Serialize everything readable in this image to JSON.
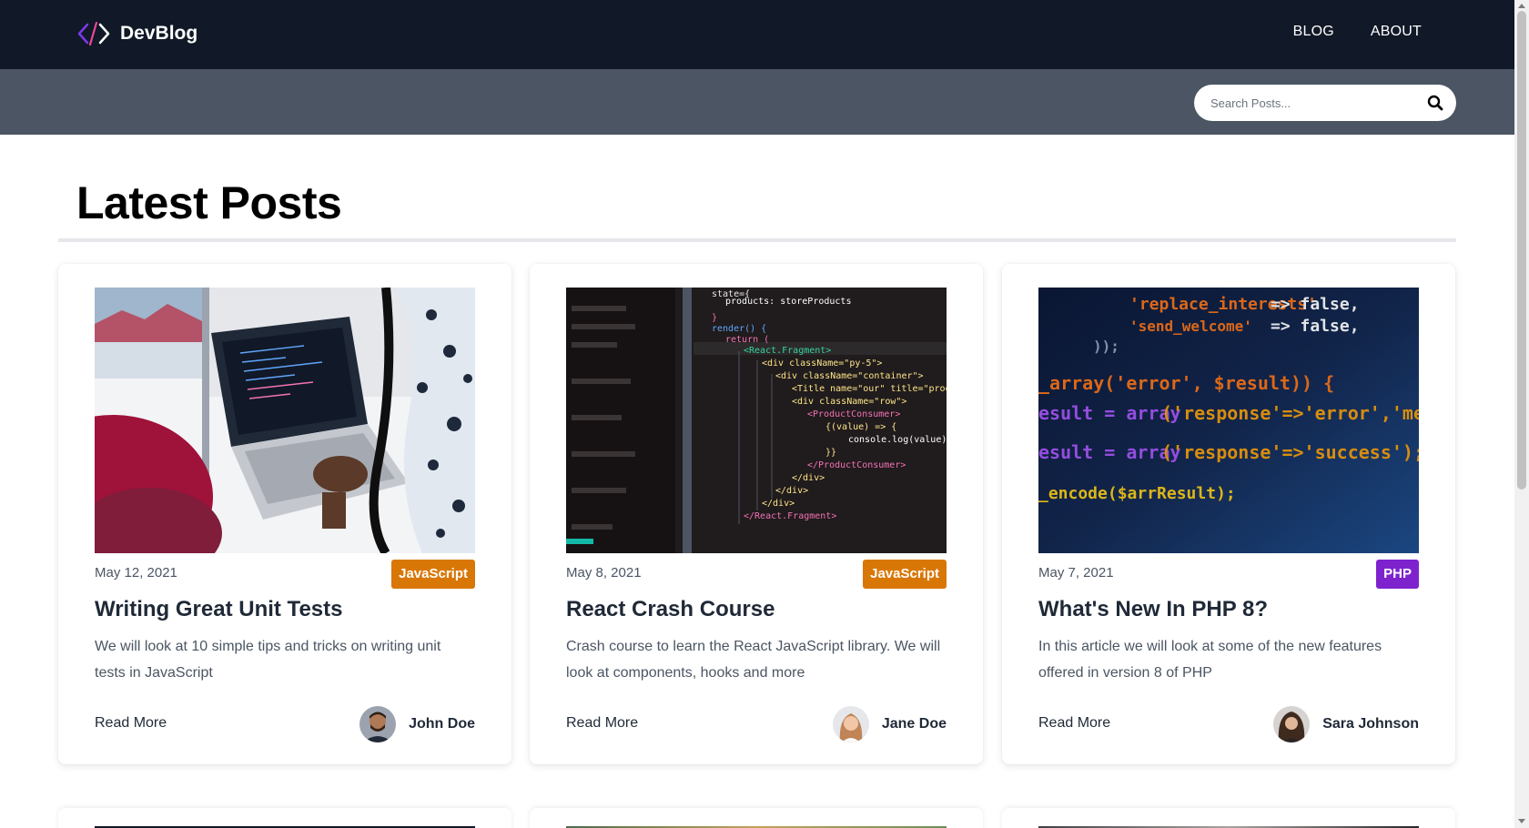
{
  "brand": {
    "name": "DevBlog",
    "icon": "code-brackets-icon"
  },
  "nav": {
    "links": [
      {
        "label": "BLOG"
      },
      {
        "label": "ABOUT"
      }
    ]
  },
  "search": {
    "placeholder": "Search Posts...",
    "icon": "search-icon"
  },
  "main": {
    "title": "Latest Posts"
  },
  "posts": [
    {
      "date": "May 12, 2021",
      "category": "JavaScript",
      "category_color": "#d97706",
      "title": "Writing Great Unit Tests",
      "excerpt": "We will look at 10 simple tips and tricks on writing unit tests in JavaScript",
      "read_more": "Read More",
      "author": "John Doe"
    },
    {
      "date": "May 8, 2021",
      "category": "JavaScript",
      "category_color": "#d97706",
      "title": "React Crash Course",
      "excerpt": "Crash course to learn the React JavaScript library. We will look at components, hooks and more",
      "read_more": "Read More",
      "author": "Jane Doe"
    },
    {
      "date": "May 7, 2021",
      "category": "PHP",
      "category_color": "#7e22ce",
      "title": "What's New In PHP 8?",
      "excerpt": "In this article we will look at some of the new features offered in version 8 of PHP",
      "read_more": "Read More",
      "author": "Sara Johnson"
    }
  ],
  "colors": {
    "navbar": "#111827",
    "subbar": "#4b5563",
    "accent_js": "#d97706",
    "accent_php": "#7e22ce"
  }
}
